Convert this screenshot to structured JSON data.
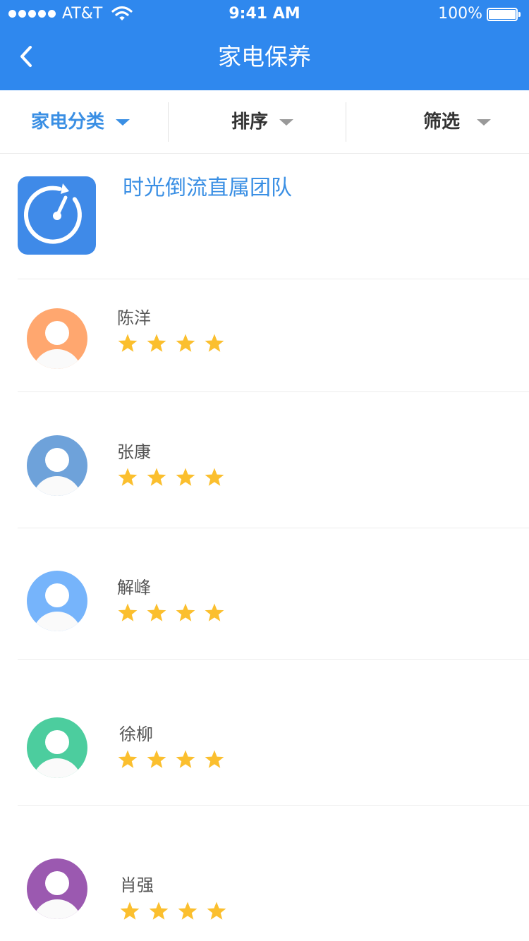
{
  "status_bar": {
    "carrier": "AT&T",
    "time": "9:41 AM",
    "battery": "100%",
    "signal_bars": 5,
    "battery_level": 1.0
  },
  "header": {
    "title": "家电保养",
    "back_icon": "chevron-left-icon"
  },
  "filters": [
    {
      "label": "家电分类",
      "active": true
    },
    {
      "label": "排序",
      "active": false
    },
    {
      "label": "筛选",
      "active": false
    }
  ],
  "team": {
    "name": "时光倒流直属团队",
    "logo_icon": "stopwatch-icon"
  },
  "members": [
    {
      "name": "陈洋",
      "rating": 4,
      "avatar_color": "#ffa76f"
    },
    {
      "name": "张康",
      "rating": 4,
      "avatar_color": "#6ea2da"
    },
    {
      "name": "解峰",
      "rating": 4,
      "avatar_color": "#76b4fb"
    },
    {
      "name": "徐柳",
      "rating": 4,
      "avatar_color": "#4ccd9e"
    },
    {
      "name": "肖强",
      "rating": 4,
      "avatar_color": "#9b59b0"
    }
  ],
  "colors": {
    "primary": "#2f88ee",
    "accent_text": "#3a8fe4",
    "star": "#fbbf2e"
  }
}
